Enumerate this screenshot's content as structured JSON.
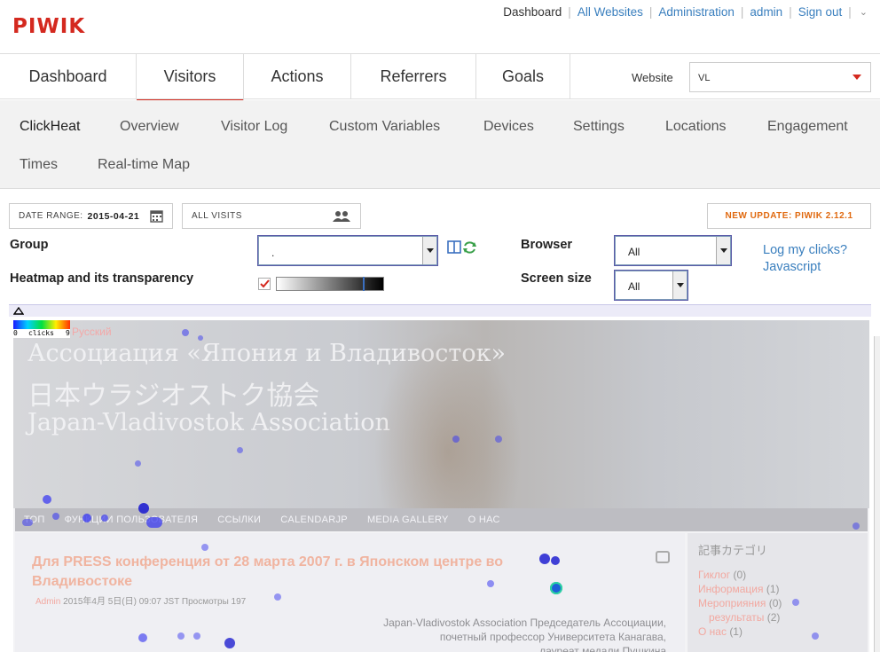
{
  "header": {
    "logo": "PIWIK",
    "nav": [
      "Dashboard",
      "All Websites",
      "Administration",
      "admin",
      "Sign out"
    ]
  },
  "main_menu": {
    "items": [
      "Dashboard",
      "Visitors",
      "Actions",
      "Referrers",
      "Goals"
    ],
    "active": "Visitors",
    "website_label": "Website",
    "website_value": "VL"
  },
  "sub_menu": {
    "items": [
      "ClickHeat",
      "Overview",
      "Visitor Log",
      "Custom Variables",
      "Devices",
      "Settings",
      "Locations",
      "Engagement",
      "Times",
      "Real-time Map"
    ],
    "active": "ClickHeat"
  },
  "controls": {
    "date_range_label": "DATE RANGE:",
    "date_range_value": "2015-04-21",
    "segment": "ALL VISITS",
    "update_notice": "NEW UPDATE: PIWIK 2.12.1",
    "group_label": "Group",
    "group_value": ".",
    "heatmap_label": "Heatmap and its transparency",
    "browser_label": "Browser",
    "browser_value": "All",
    "screen_label": "Screen size",
    "screen_value": "All",
    "log_clicks": "Log my clicks?",
    "javascript": "Javascript"
  },
  "legend": {
    "min": "0",
    "caption": "clicks",
    "max": "9"
  },
  "page_preview": {
    "lang_link": "Русский",
    "title_ru": "Ассоциация «Япония и Владивосток»",
    "title_jp": "日本ウラジオストク協会",
    "title_en": "Japan-Vladivostok Association",
    "nav": [
      "ТОП",
      "ФУНКЦИИ ПОЛЬЗОВАТЕЛЯ",
      "ССЫЛКИ",
      "CALENDARJP",
      "MEDIA GALLERY",
      "О НАС"
    ],
    "post_title": "Для PRESS конференция от 28 марта 2007 г. в Японском центре во Владивостоке",
    "post_author": "Admin",
    "post_meta": "2015年4月 5日(日) 09:07 JST Просмотры 197",
    "post_body": [
      "Japan-Vladivostok Association Председатель Ассоциации,",
      "почетный профессор Университета Канагава,",
      "лауреат медали Пушкина"
    ],
    "side_title": "記事カテゴリ",
    "categories": [
      {
        "name": "Гиклог",
        "count": "(0)"
      },
      {
        "name": "Информация",
        "count": "(1)"
      },
      {
        "name": "Мероприяния",
        "count": "(0)"
      },
      {
        "name": "результаты",
        "count": "(2)"
      },
      {
        "name": "О нас",
        "count": "(1)"
      }
    ]
  },
  "colors": {
    "brand": "#d4291f",
    "link": "#3a7fbe",
    "update": "#e0690f"
  }
}
